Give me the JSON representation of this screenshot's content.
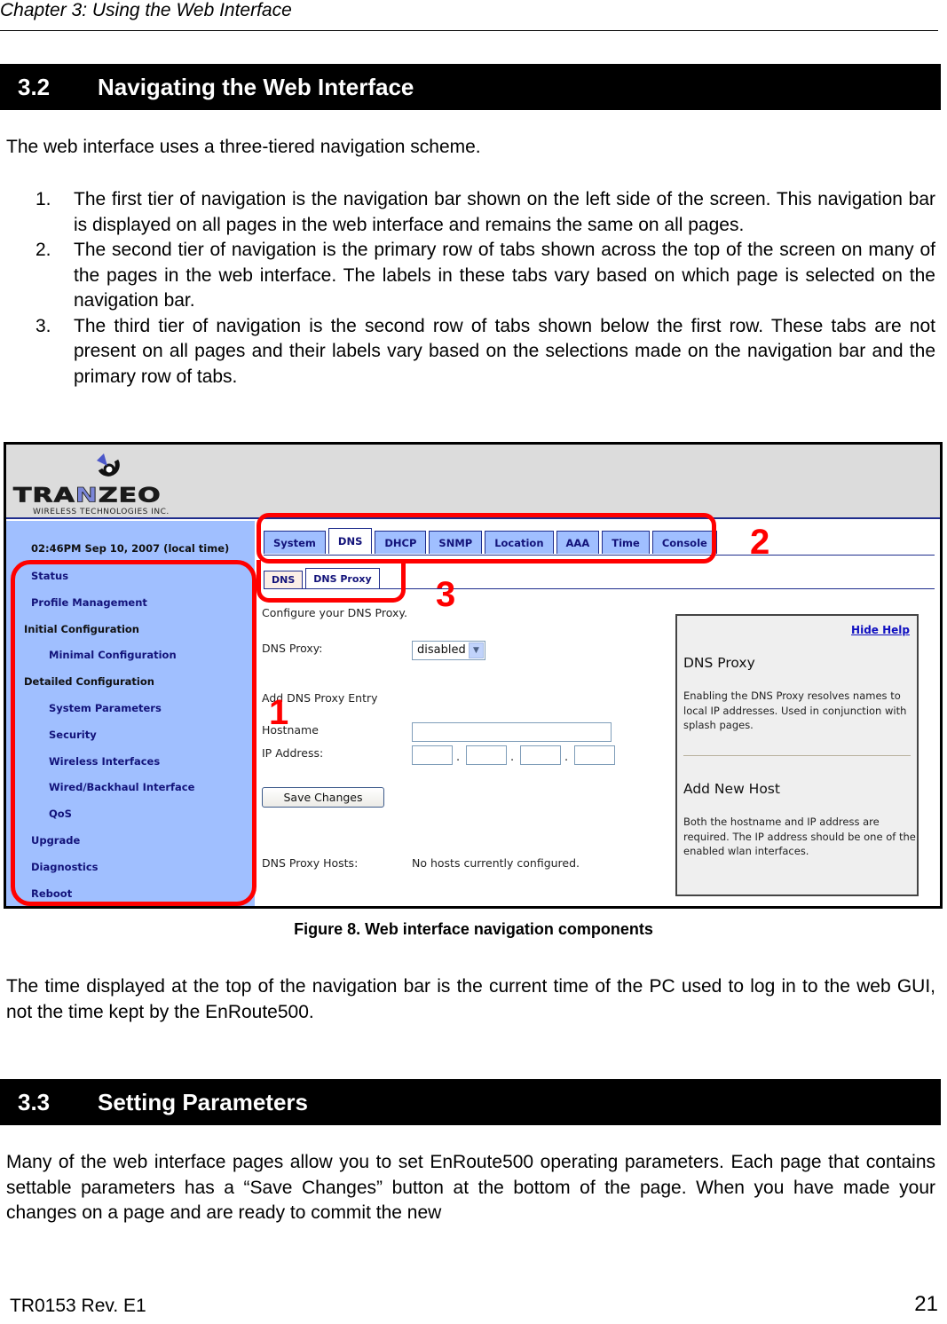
{
  "running_head": "Chapter 3: Using the Web Interface",
  "section_32": {
    "number": "3.2",
    "title": "Navigating the Web Interface"
  },
  "intro": "The web interface uses a three-tiered navigation scheme.",
  "list": [
    {
      "marker": "1.",
      "text": "The first tier of navigation is the navigation bar shown on the left side of the screen. This navigation bar is displayed on all pages in the web interface and remains the same on all pages."
    },
    {
      "marker": "2.",
      "text": "The second tier of navigation is the primary row of tabs shown across the top of the screen on many of the pages in the web interface. The labels in these tabs vary based on which page is selected on the navigation bar."
    },
    {
      "marker": "3.",
      "text": "The third tier of navigation is the second row of tabs shown below the first row. These tabs are not present on all pages and their labels vary based on the selections made on the navigation bar and the primary row of tabs."
    }
  ],
  "figure": {
    "logo": {
      "word_pre": "TRA",
      "word_hl": "N",
      "word_post": "ZEO",
      "tagline": "WIRELESS TECHNOLOGIES INC."
    },
    "time": "02:46PM Sep 10, 2007 (local time)",
    "nav": [
      {
        "label": "Status",
        "level": "top"
      },
      {
        "label": "Profile Management",
        "level": "top"
      },
      {
        "label": "Initial Configuration",
        "level": "group"
      },
      {
        "label": "Minimal Configuration",
        "level": "sub"
      },
      {
        "label": "Detailed Configuration",
        "level": "group"
      },
      {
        "label": "System Parameters",
        "level": "sub"
      },
      {
        "label": "Security",
        "level": "sub"
      },
      {
        "label": "Wireless Interfaces",
        "level": "sub"
      },
      {
        "label": "Wired/Backhaul Interface",
        "level": "sub"
      },
      {
        "label": "QoS",
        "level": "sub"
      },
      {
        "label": "Upgrade",
        "level": "top"
      },
      {
        "label": "Diagnostics",
        "level": "top"
      },
      {
        "label": "Reboot",
        "level": "top"
      }
    ],
    "primary_tabs": [
      "System",
      "DNS",
      "DHCP",
      "SNMP",
      "Location",
      "AAA",
      "Time",
      "Console"
    ],
    "primary_active": "DNS",
    "secondary_tabs": [
      "DNS",
      "DNS Proxy"
    ],
    "secondary_active": "DNS Proxy",
    "form": {
      "intro": "Configure your DNS Proxy.",
      "dns_proxy_label": "DNS Proxy:",
      "dns_proxy_value": "disabled",
      "add_entry_heading": "Add DNS Proxy Entry",
      "hostname_label": "Hostname",
      "hostname_value": "",
      "ip_label": "IP Address:",
      "ip_octets": [
        "",
        "",
        "",
        ""
      ],
      "ip_separator": ".",
      "save_label": "Save Changes",
      "hosts_label": "DNS Proxy Hosts:",
      "hosts_value": "No hosts currently configured."
    },
    "help": {
      "hide_label": "Hide Help",
      "h1": "DNS Proxy",
      "p1": "Enabling the DNS Proxy resolves names to local IP addresses. Used in conjunction with splash pages.",
      "h2": "Add New Host",
      "p2": "Both the hostname and IP address are required. The IP address should be one of the enabled wlan interfaces."
    },
    "callouts": [
      "1",
      "2",
      "3"
    ],
    "callout_color": "#ff0000",
    "nav_bg_color": "#a0bfff"
  },
  "caption": "Figure 8. Web interface navigation components",
  "time_note": "The time displayed at the top of the navigation bar is the current time of the PC used to log in to the web GUI, not the time kept by the EnRoute500.",
  "section_33": {
    "number": "3.3",
    "title": "Setting Parameters"
  },
  "params_text": "Many of the web interface pages allow you to set EnRoute500 operating parameters. Each page that contains settable parameters has a “Save Changes” button at the bottom of the page. When you have made your changes on a page and are ready to commit the new",
  "footer": {
    "doc_id": "TR0153 Rev. E1",
    "page": "21"
  }
}
